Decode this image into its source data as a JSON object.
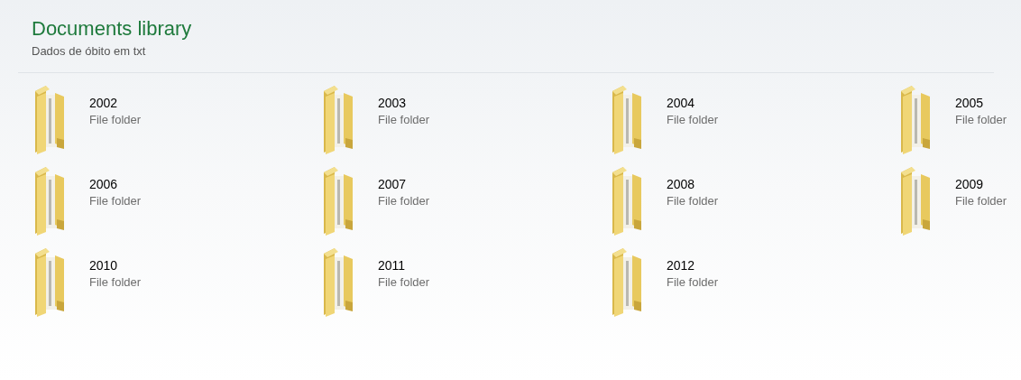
{
  "header": {
    "title": "Documents library",
    "subtitle": "Dados de óbito em txt"
  },
  "items": [
    {
      "name": "2002",
      "type": "File folder"
    },
    {
      "name": "2003",
      "type": "File folder"
    },
    {
      "name": "2004",
      "type": "File folder"
    },
    {
      "name": "2005",
      "type": "File folder"
    },
    {
      "name": "2006",
      "type": "File folder"
    },
    {
      "name": "2007",
      "type": "File folder"
    },
    {
      "name": "2008",
      "type": "File folder"
    },
    {
      "name": "2009",
      "type": "File folder"
    },
    {
      "name": "2010",
      "type": "File folder"
    },
    {
      "name": "2011",
      "type": "File folder"
    },
    {
      "name": "2012",
      "type": "File folder"
    }
  ]
}
